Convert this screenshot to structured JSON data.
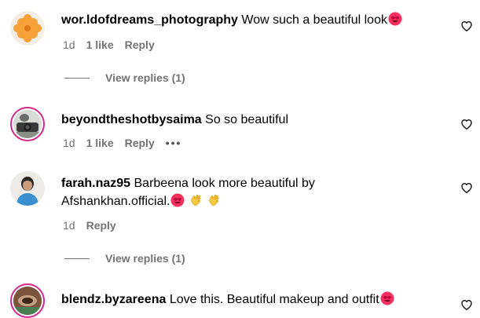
{
  "comments": [
    {
      "username": "wor.ldofdreams_photography",
      "text": "Wow such a beautiful look",
      "emoji": "heart-eyes",
      "age": "1d",
      "likes": "1 like",
      "reply": "Reply",
      "view_replies": "View replies (1)"
    },
    {
      "username": "beyondtheshotbysaima",
      "text": "So so beautiful",
      "age": "1d",
      "likes": "1 like",
      "reply": "Reply",
      "more": "•••"
    },
    {
      "username": "farah.naz95",
      "text": "Barbeena look more beautiful by",
      "text_line2": "Afshankhan.official.",
      "age": "1d",
      "reply": "Reply",
      "view_replies": "View replies (1)"
    },
    {
      "username": "blendz.byzareena",
      "text": "Love this. Beautiful makeup and outfit",
      "emoji": "heart-eyes"
    }
  ],
  "colors": {
    "meta_gray": "#737373",
    "story_ring": "#d1298a",
    "emoji_face": "#f5305f",
    "clap_yellow": "#f7c843"
  }
}
